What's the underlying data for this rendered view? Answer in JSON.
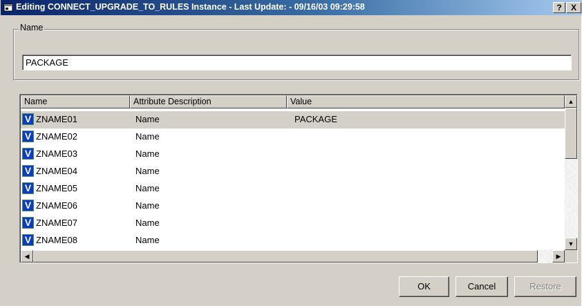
{
  "window": {
    "title": "Editing CONNECT_UPGRADE_TO_RULES Instance - Last Update: - 09/16/03 09:29:58",
    "help_label": "?",
    "close_label": "X"
  },
  "name_group": {
    "label": "Name",
    "value": "PACKAGE"
  },
  "grid": {
    "columns": [
      "Name",
      "Attribute Description",
      "Value"
    ],
    "icon_letter": "V",
    "rows": [
      {
        "name": "ZNAME01",
        "desc": "Name",
        "value": "PACKAGE"
      },
      {
        "name": "ZNAME02",
        "desc": "Name",
        "value": ""
      },
      {
        "name": "ZNAME03",
        "desc": "Name",
        "value": ""
      },
      {
        "name": "ZNAME04",
        "desc": "Name",
        "value": ""
      },
      {
        "name": "ZNAME05",
        "desc": "Name",
        "value": ""
      },
      {
        "name": "ZNAME06",
        "desc": "Name",
        "value": ""
      },
      {
        "name": "ZNAME07",
        "desc": "Name",
        "value": ""
      },
      {
        "name": "ZNAME08",
        "desc": "Name",
        "value": ""
      }
    ]
  },
  "buttons": {
    "ok": "OK",
    "cancel": "Cancel",
    "restore": "Restore"
  }
}
